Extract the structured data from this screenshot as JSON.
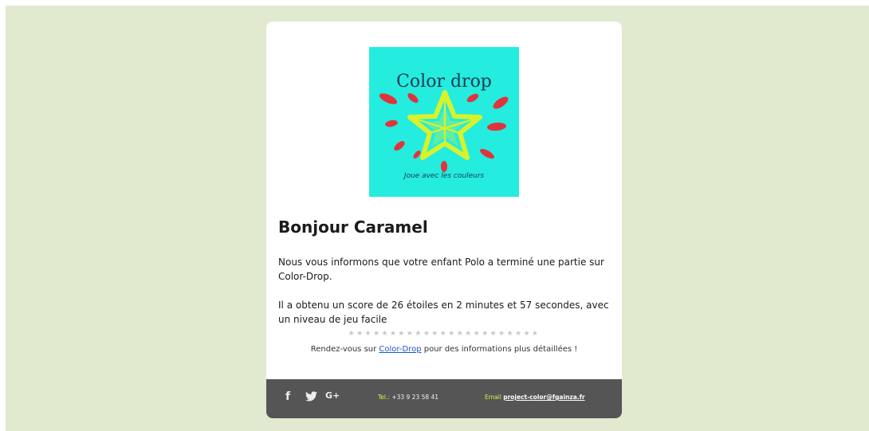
{
  "email": {
    "logo": {
      "title": "Color drop",
      "tagline": "Joue avec les couleurs"
    },
    "greeting": "Bonjour Caramel",
    "paragraph_1": "Nous vous informons que votre enfant Polo a terminé une partie sur Color-Drop.",
    "paragraph_2": "Il a obtenu un score de 26 étoiles en 2 minutes et 57 secondes, avec un niveau de jeu facile",
    "separator": "★★★★★★★★★★★★★★★★★★★★★★★",
    "cta": {
      "before": "Rendez-vous sur ",
      "link": "Color-Drop",
      "after": " pour des informations plus détaillées !"
    },
    "footer": {
      "social": [
        "f",
        "G+"
      ],
      "tel_label": "Tel.:",
      "tel_value": "+33 9 23 58 41",
      "email_label": "Email",
      "email_value": "project-color@fgainza.fr"
    }
  },
  "colors": {
    "page_background": "#e1e9cf",
    "card_background": "#ffffff",
    "logo_background": "#24ecdf",
    "star": "#d8f22a",
    "brush_strokes": "#e0343c",
    "footer_background": "#555555",
    "footer_accent": "#d8f04a",
    "link": "#1a56c8"
  }
}
